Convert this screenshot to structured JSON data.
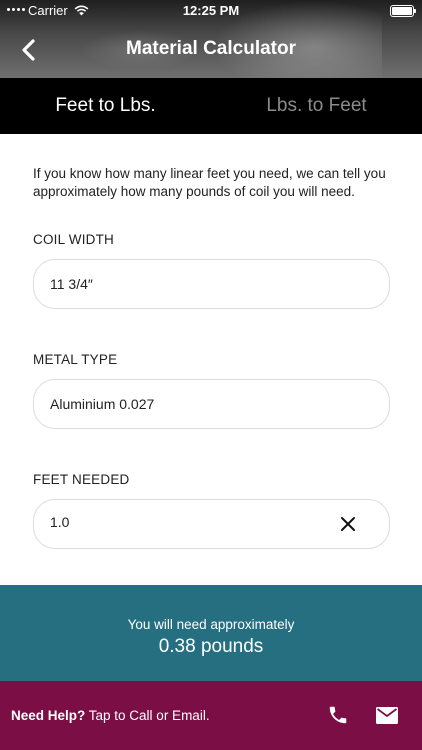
{
  "status_bar": {
    "carrier": "Carrier",
    "time": "12:25 PM"
  },
  "nav": {
    "title": "Material Calculator",
    "back_icon": "chevron-left-icon"
  },
  "tabs": [
    {
      "label": "Feet to Lbs.",
      "active": true
    },
    {
      "label": "Lbs. to Feet",
      "active": false
    }
  ],
  "intro": "If you know how many linear feet you need, we can tell you approximately how many pounds of coil you will need.",
  "fields": {
    "coil_width": {
      "label": "COIL WIDTH",
      "value": "11 3/4″"
    },
    "metal_type": {
      "label": "METAL TYPE",
      "value": "Aluminium 0.027"
    },
    "feet_needed": {
      "label": "FEET NEEDED",
      "value": "1.0"
    }
  },
  "result": {
    "caption": "You will need approximately",
    "value": "0.38 pounds"
  },
  "footer": {
    "help_bold": "Need Help?",
    "help_text": " Tap to Call or Email."
  },
  "colors": {
    "tab_bar": "#000000",
    "result_bg": "#256f80",
    "footer_bg": "#7c0e46"
  }
}
